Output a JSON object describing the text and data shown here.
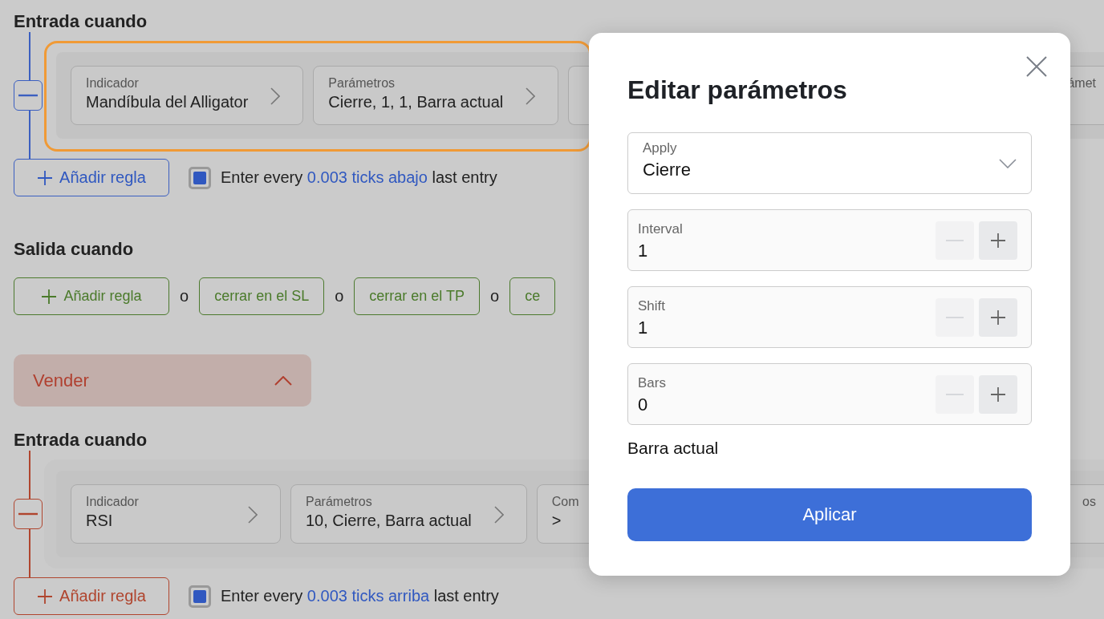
{
  "buy_entry": {
    "kind": "buy",
    "title": "Entrada cuando",
    "rules": [
      {
        "highlighted": true,
        "fields": [
          {
            "kind": "field",
            "label": "Indicador",
            "value": "Mandíbula del Alligator"
          },
          {
            "kind": "field",
            "label": "Parámetros",
            "value": "Cierre, 1, 1, Barra actual"
          },
          {
            "kind": "partial",
            "label": "ámet"
          }
        ]
      }
    ],
    "add_rule": "Añadir regla",
    "entry_rule": {
      "checked": true,
      "prefix": "Enter every",
      "link": "0.003 ticks abajo",
      "suffix": "last entry"
    }
  },
  "exit": {
    "title": "Salida cuando",
    "items": [
      {
        "kind": "add",
        "label": "Añadir regla"
      },
      {
        "kind": "sep",
        "label": "o"
      },
      {
        "kind": "action",
        "label": "cerrar en el SL"
      },
      {
        "kind": "sep",
        "label": "o"
      },
      {
        "kind": "action",
        "label": "cerrar en el TP"
      },
      {
        "kind": "sep",
        "label": "o"
      },
      {
        "kind": "action",
        "label": "ce"
      }
    ]
  },
  "sell_header": {
    "label": "Vender",
    "expanded": true
  },
  "sell_entry": {
    "kind": "sell",
    "title": "Entrada cuando",
    "rules": [
      {
        "highlighted": false,
        "fields": [
          {
            "kind": "field",
            "label": "Indicador",
            "value": "RSI"
          },
          {
            "kind": "field",
            "label": "Parámetros",
            "value": "10, Cierre, Barra actual"
          },
          {
            "kind": "hidden",
            "label": "Com",
            "value": ">"
          },
          {
            "kind": "partial",
            "label": "os"
          }
        ]
      }
    ],
    "add_rule": "Añadir regla",
    "entry_rule": {
      "checked": true,
      "prefix": "Enter every",
      "link": "0.003 ticks arriba",
      "suffix": "last entry"
    }
  },
  "dialog": {
    "title": "Editar parámetros",
    "select": {
      "label": "Apply",
      "value": "Cierre"
    },
    "numbers": [
      {
        "label": "Interval",
        "value": "1",
        "minus_disabled": true
      },
      {
        "label": "Shift",
        "value": "1",
        "minus_disabled": true
      },
      {
        "label": "Bars",
        "value": "0",
        "minus_disabled": true
      }
    ],
    "note": "Barra actual",
    "apply": "Aplicar"
  }
}
